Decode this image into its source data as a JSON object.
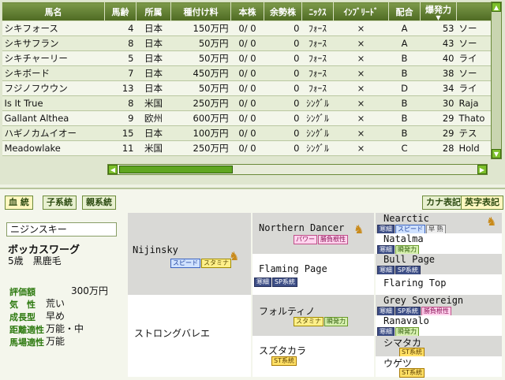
{
  "table": {
    "headers": [
      "馬名",
      "馬齢",
      "所属",
      "種付け料",
      "本株",
      "余勢株",
      "ﾆｯｸｽ",
      "ｲﾝﾌﾞﾘｰﾄﾞ",
      "配合",
      "爆発力",
      ""
    ],
    "rows": [
      [
        "シキフォース",
        "4",
        "日本",
        "150万円",
        "0/ 0",
        "0",
        "ﾌｫｰｽ",
        "×",
        "A",
        "53",
        "ソー"
      ],
      [
        "シキサフラン",
        "8",
        "日本",
        "50万円",
        "0/ 0",
        "0",
        "ﾌｫｰｽ",
        "×",
        "A",
        "43",
        "ソー"
      ],
      [
        "シキチャーリー",
        "5",
        "日本",
        "50万円",
        "0/ 0",
        "0",
        "ﾌｫｰｽ",
        "×",
        "B",
        "40",
        "ライ"
      ],
      [
        "シキボード",
        "7",
        "日本",
        "450万円",
        "0/ 0",
        "0",
        "ﾌｫｰｽ",
        "×",
        "B",
        "38",
        "ソー"
      ],
      [
        "フジノフウウン",
        "13",
        "日本",
        "50万円",
        "0/ 0",
        "0",
        "ﾌｫｰｽ",
        "×",
        "D",
        "34",
        "ライ"
      ],
      [
        "Is It True",
        "8",
        "米国",
        "250万円",
        "0/ 0",
        "0",
        "ｼﾝｸﾞﾙ",
        "×",
        "B",
        "30",
        "Raja"
      ],
      [
        "Gallant Althea",
        "9",
        "欧州",
        "600万円",
        "0/ 0",
        "0",
        "ｼﾝｸﾞﾙ",
        "×",
        "B",
        "29",
        "Thato"
      ],
      [
        "ハギノカムイオー",
        "15",
        "日本",
        "100万円",
        "0/ 0",
        "0",
        "ｼﾝｸﾞﾙ",
        "×",
        "B",
        "29",
        "テス"
      ],
      [
        "Meadowlake",
        "11",
        "米国",
        "250万円",
        "0/ 0",
        "0",
        "ｼﾝｸﾞﾙ",
        "×",
        "C",
        "28",
        "Hold"
      ]
    ]
  },
  "tabs": {
    "pedigree": "血 統",
    "child_line": "子系統",
    "parent_line": "親系統",
    "kana": "カナ表記",
    "english": "英字表記"
  },
  "horse": {
    "line_name": "ニジンスキー",
    "name": "ボッカスワーグ",
    "age_color": "5歳　黒鹿毛"
  },
  "stats": [
    {
      "label": "評価額",
      "value": "300万円"
    },
    {
      "label": "気　性",
      "value": "荒い"
    },
    {
      "label": "成長型",
      "value": "早め"
    },
    {
      "label": "距離適性",
      "value": "万能・中"
    },
    {
      "label": "馬場適性",
      "value": "万能"
    }
  ],
  "pedigree": {
    "sire": "Nijinsky",
    "dam": "ストロングバレエ",
    "ss": "Northern Dancer",
    "sd": "Flaming Page",
    "ds": "フォルティノ",
    "dd": "スズタカラ",
    "sss": "Nearctic",
    "ssd": "Natalma",
    "sds": "Bull Page",
    "sdd": "Flaring Top",
    "dss": "Grey Sovereign",
    "dsd": "Ranavalo",
    "dds": "シマタカ",
    "ddd": "ウゲツ"
  },
  "badges": {
    "speed": "スピード",
    "stamina": "スタミナ",
    "power": "パワー",
    "kishou": "勝負根性",
    "kanbo": "寒細",
    "sp": "SP系統",
    "st": "ST系統",
    "hayajuku": "早 熟",
    "shunpatsu": "瞬発力"
  },
  "icons": {
    "horse": "horse-icon"
  }
}
